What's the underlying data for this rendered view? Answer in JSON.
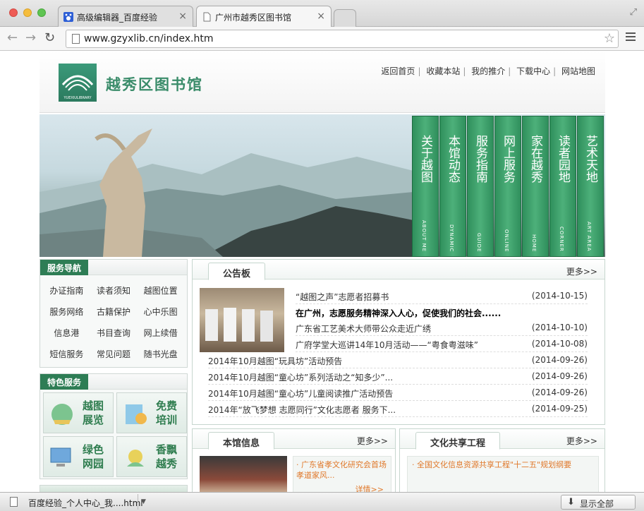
{
  "browser": {
    "tabs": [
      {
        "title": "高级编辑器_百度经验"
      },
      {
        "title": "广州市越秀区图书馆"
      }
    ],
    "url": "www.gzyxlib.cn/index.htm"
  },
  "header": {
    "logo_text": "越秀区图书馆",
    "logo_sub": "YUEXIULIBRARY",
    "top_links": [
      "返回首页",
      "收藏本站",
      "我的推介",
      "下载中心",
      "网站地图"
    ]
  },
  "banner_tabs": [
    {
      "cn": "关于越图",
      "en": "ABOUT ME"
    },
    {
      "cn": "本馆动态",
      "en": "DYNAMIC"
    },
    {
      "cn": "服务指南",
      "en": "GUIDE"
    },
    {
      "cn": "网上服务",
      "en": "ONLINE"
    },
    {
      "cn": "家在越秀",
      "en": "HOME"
    },
    {
      "cn": "读者园地",
      "en": "CORNER"
    },
    {
      "cn": "艺术天地",
      "en": "ART AREA"
    }
  ],
  "service_nav": {
    "title": "服务导航",
    "rows": [
      [
        "办证指南",
        "读者须知",
        "越图位置"
      ],
      [
        "服务网络",
        "古籍保护",
        "心中乐图"
      ],
      [
        "信息港",
        "书目查询",
        "网上续借"
      ],
      [
        "短信服务",
        "常见问题",
        "随书光盘"
      ]
    ]
  },
  "featured": {
    "title": "特色服务",
    "items": [
      {
        "l1": "越图",
        "l2": "展览"
      },
      {
        "l1": "免费",
        "l2": "培训"
      },
      {
        "l1": "绿色",
        "l2": "网园"
      },
      {
        "l1": "香飘",
        "l2": "越秀"
      }
    ]
  },
  "notice": {
    "title": "公告板",
    "more": "更多>>",
    "items": [
      {
        "title": "“越图之声”志愿者招募书",
        "date": "(2014-10-15)"
      },
      {
        "title": "在广州，志愿服务精神深入人心，促使我们的社会......",
        "date": ""
      },
      {
        "title": "广东省工艺美术大师带公众走近广绣",
        "date": "(2014-10-10)"
      },
      {
        "title": "广府学堂大巡讲14年10月活动——“粤食粤滋味”",
        "date": "(2014-10-08)"
      },
      {
        "title": "2014年10月越图“玩具坊”活动预告",
        "date": "(2014-09-26)"
      },
      {
        "title": "2014年10月越图“童心坊”系列活动之“知多少”...",
        "date": "(2014-09-26)"
      },
      {
        "title": "2014年10月越图“童心坊”儿童阅读推广活动预告",
        "date": "(2014-09-26)"
      },
      {
        "title": "2014年“放飞梦想 志愿同行”文化志愿者 服务下...",
        "date": "(2014-09-25)"
      }
    ]
  },
  "library_info": {
    "title": "本馆信息",
    "more": "更多>>",
    "headline": "· 广东省孝文化研究会首场孝道家风...",
    "detail": "详情>>"
  },
  "culture_share": {
    "title": "文化共享工程",
    "more": "更多>>",
    "headline": "· 全国文化信息资源共享工程\"十二五\"规划纲要"
  },
  "download_bar": {
    "file": "百度经验_个人中心_我....html",
    "show_all": "显示全部"
  }
}
